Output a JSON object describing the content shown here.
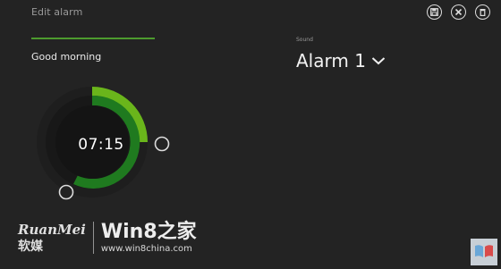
{
  "header": {
    "title": "Edit alarm"
  },
  "toolbar": {
    "buttons": [
      {
        "name": "save-button",
        "icon": "save-icon"
      },
      {
        "name": "close-button",
        "icon": "close-icon"
      },
      {
        "name": "delete-button",
        "icon": "trash-icon"
      }
    ]
  },
  "alarm": {
    "name": "Good morning",
    "time": "07:15",
    "hour": 7,
    "minute": 15
  },
  "sound": {
    "label": "Sound",
    "value": "Alarm 1"
  },
  "watermark": {
    "brand": "RuanMei",
    "brand_cn": "软媒",
    "site": "Win8之家",
    "url": "www.win8china.com"
  },
  "colors": {
    "background": "#232323",
    "accent_light": "#6ab51b",
    "accent_dark": "#1f7a1f",
    "dial_track": "#1a1a1a"
  }
}
